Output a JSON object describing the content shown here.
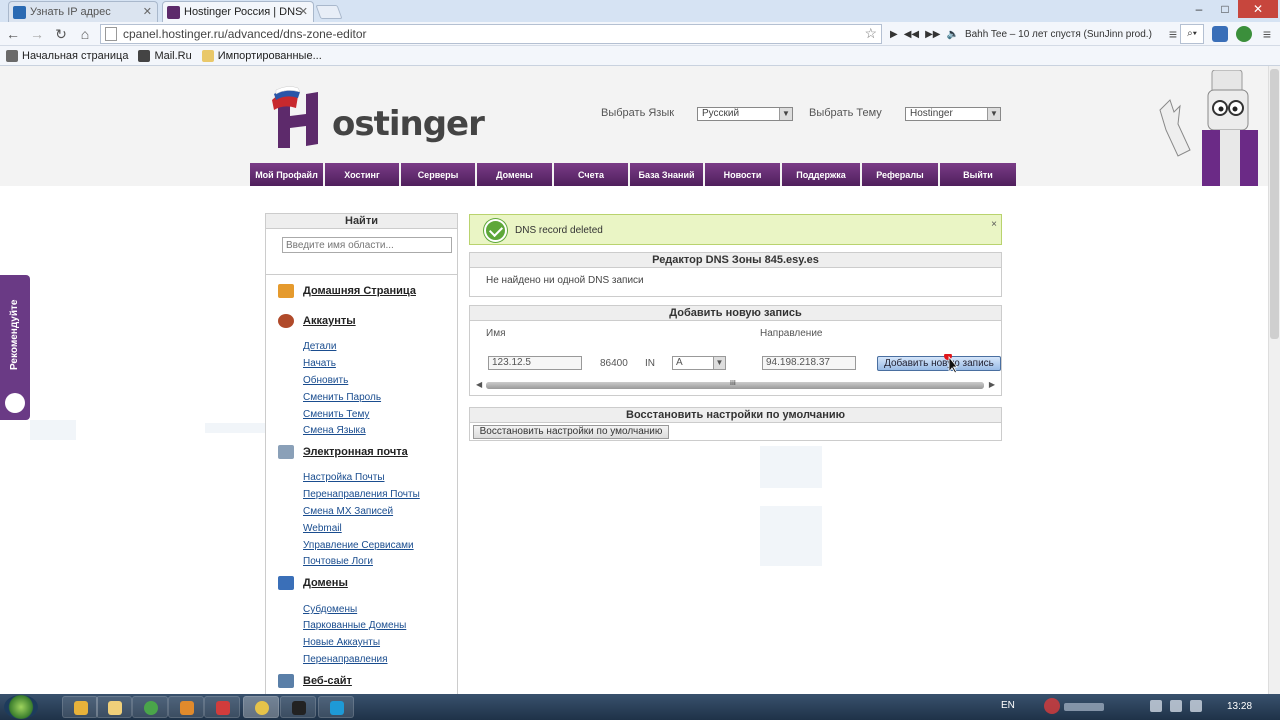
{
  "browser": {
    "tabs": [
      {
        "title": "Узнать IP адрес",
        "favicon": "ip-icon",
        "active": false
      },
      {
        "title": "Hostinger Россия | DNS Z",
        "favicon": "hostinger-favicon",
        "active": true
      }
    ],
    "url": "cpanel.hostinger.ru/advanced/dns-zone-editor",
    "now_playing": "Bahh Tee – 10 лет спустя (SunJinn prod.)",
    "bookmarks": [
      "Начальная страница",
      "Mail.Ru",
      "Импортированные..."
    ]
  },
  "header": {
    "logo_text": "ostinger",
    "language_label": "Выбрать Язык",
    "language_value": "Русский",
    "theme_label": "Выбрать Тему",
    "theme_value": "Hostinger"
  },
  "nav": [
    "Мой Профайл",
    "Хостинг",
    "Серверы",
    "Домены",
    "Счета",
    "База Знаний",
    "Новости",
    "Поддержка",
    "Рефералы",
    "Выйти"
  ],
  "recommend": {
    "label": "Рекомендуйте"
  },
  "sidebar": {
    "find_title": "Найти",
    "find_placeholder": "Введите имя области...",
    "sections": [
      {
        "title": "Домашняя Страница",
        "icon": "home-icon",
        "links": []
      },
      {
        "title": "Аккаунты",
        "icon": "user-icon",
        "links": [
          "Детали",
          "Начать",
          "Обновить",
          "Сменить Пароль",
          "Сменить Тему",
          "Смена Языка"
        ]
      },
      {
        "title": "Электронная почта",
        "icon": "mail-icon",
        "links": [
          "Настройка Почты",
          "Перенаправления Почты",
          "Смена MX Записей",
          "Webmail",
          "Управление Сервисами",
          "Почтовые Логи"
        ]
      },
      {
        "title": "Домены",
        "icon": "domain-icon",
        "links": [
          "Субдомены",
          "Паркованные Домены",
          "Новые Аккаунты",
          "Перенаправления"
        ]
      },
      {
        "title": "Веб-сайт",
        "icon": "website-icon",
        "links": []
      }
    ]
  },
  "alert": {
    "message": "DNS record deleted",
    "close": "×"
  },
  "dns_editor": {
    "title": "Редактор DNS Зоны 845.esy.es",
    "empty_text": "Не найдено ни одной DNS записи"
  },
  "add_record": {
    "title": "Добавить новую запись",
    "name_label": "Имя",
    "name_value": "123.12.5",
    "ttl": "86400",
    "class": "IN",
    "type_value": "A",
    "target_label": "Направление",
    "target_value": "94.198.218.37",
    "add_button": "Добавить новую запись",
    "scroll_grip": "III"
  },
  "restore": {
    "title": "Восстановить настройки по умолчанию",
    "button": "Восстановить настройки по умолчанию"
  },
  "taskbar": {
    "lang": "EN",
    "clock": "13:28"
  },
  "colors": {
    "nav_purple": "#5d2a6b",
    "alert_bg": "#eaf5c5",
    "success_green": "#5ea73a",
    "link_blue": "#1a4d8f"
  }
}
